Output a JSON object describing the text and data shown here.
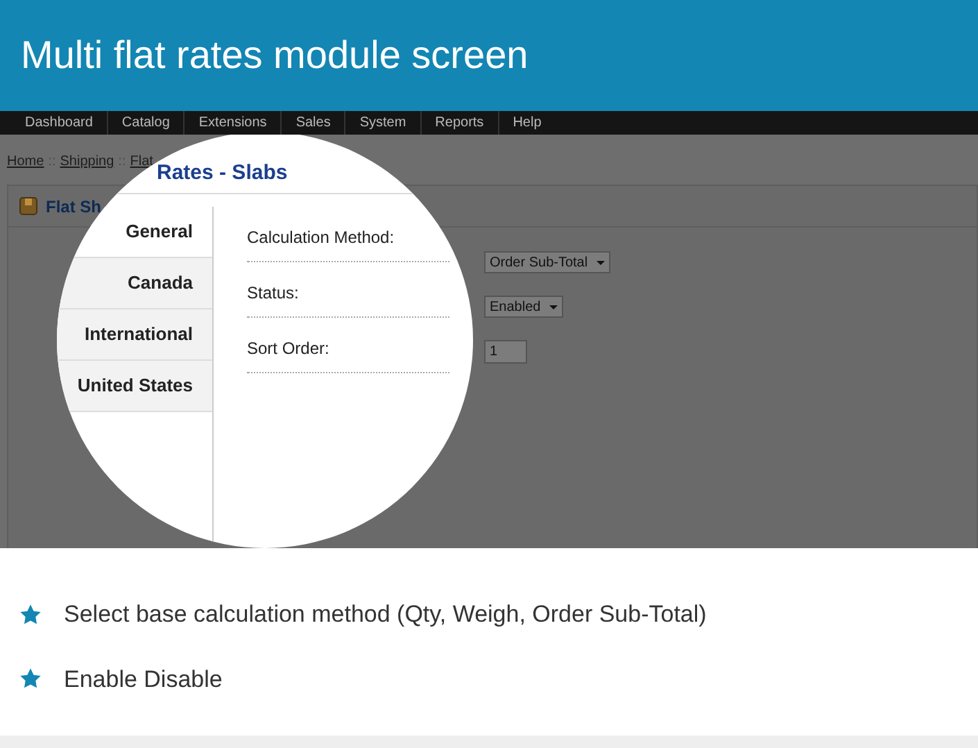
{
  "header": {
    "title": "Multi flat rates module screen"
  },
  "nav": [
    "Dashboard",
    "Catalog",
    "Extensions",
    "Sales",
    "System",
    "Reports",
    "Help"
  ],
  "screen": {
    "breadcrumb": [
      "Home",
      "Shipping",
      "Flat"
    ],
    "separator": "::",
    "page_title": "Rates - Slabs",
    "panel_title": "Flat Sh",
    "tabs": [
      {
        "label": "General",
        "selected": true
      },
      {
        "label": "Canada",
        "selected": false
      },
      {
        "label": "International",
        "selected": false
      },
      {
        "label": "United States",
        "selected": false
      }
    ],
    "fields": [
      {
        "label": "Calculation Method:",
        "kind": "select",
        "value": "Order Sub-Total"
      },
      {
        "label": "Status:",
        "kind": "select",
        "value": "Enabled"
      },
      {
        "label": "Sort Order:",
        "kind": "input",
        "value": "1"
      }
    ]
  },
  "features": [
    "Select base calculation method (Qty, Weigh, Order Sub-Total)",
    "Enable Disable"
  ]
}
